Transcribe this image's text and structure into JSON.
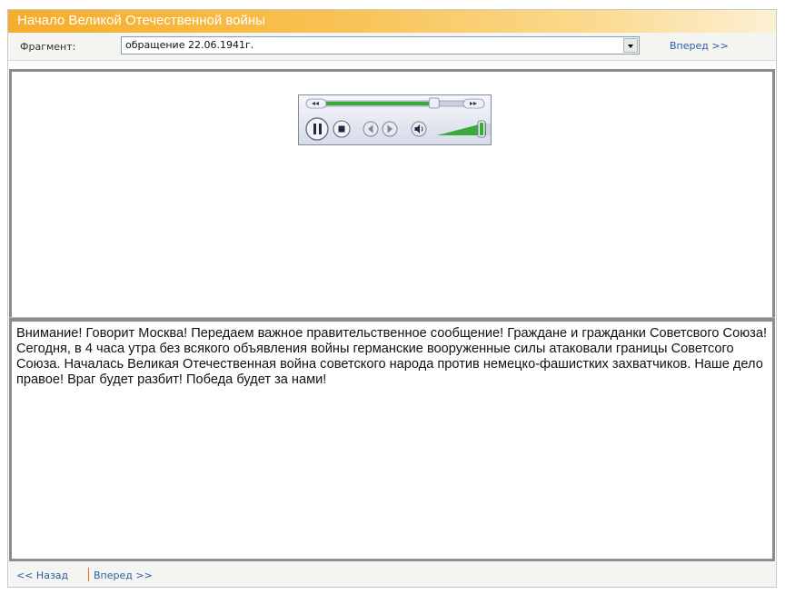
{
  "window": {
    "title": "Начало Великой Отечественной войны"
  },
  "fragment": {
    "label": "Фрагмент:",
    "selected": "обращение 22.06.1941г.",
    "next_label": "Вперед >>"
  },
  "player": {
    "seek_progress": 0.72,
    "volume_level": 1.0,
    "icons": [
      "rewind-icon",
      "fast-forward-icon",
      "pause-icon",
      "stop-icon",
      "previous-icon",
      "next-icon",
      "volume-icon"
    ]
  },
  "content": {
    "text": "Внимание! Говорит Москва! Передаем важное правительственное сообщение! Граждане и гражданки Советсвого Союза! Сегодня, в 4 часа утра без всякого объявления войны германские вооруженные силы атаковали границы Советсого Союза. Началась Великая Отечественная война советского народа против немецко-фашистких захватчиков. Наше дело правое! Враг будет разбит! Победа будет за нами!"
  },
  "footer": {
    "back_label": "<< Назад",
    "next_label": "Вперед >>"
  },
  "colors": {
    "title_bar": "#f5ad2c",
    "link": "#2b5fa8",
    "panel_border": "#8c8c8c",
    "player_accent": "#3aaa3a"
  }
}
